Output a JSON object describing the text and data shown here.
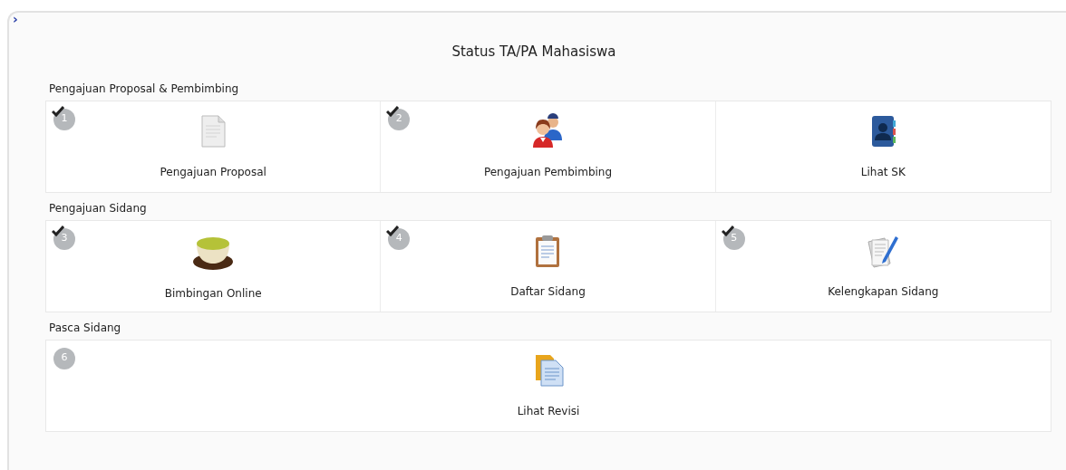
{
  "toggle": "›",
  "title": "Status TA/PA Mahasiswa",
  "sections": [
    {
      "heading": "Pengajuan Proposal & Pembimbing",
      "tiles": [
        {
          "step": "1",
          "checked": true,
          "kind": "document",
          "label": "Pengajuan Proposal"
        },
        {
          "step": "2",
          "checked": true,
          "kind": "people",
          "label": "Pengajuan Pembimbing"
        },
        {
          "kind": "contacts-book",
          "label": "Lihat SK"
        }
      ]
    },
    {
      "heading": "Pengajuan Sidang",
      "tiles": [
        {
          "step": "3",
          "checked": true,
          "kind": "tea",
          "label": "Bimbingan Online"
        },
        {
          "step": "4",
          "checked": true,
          "kind": "clipboard",
          "label": "Daftar Sidang"
        },
        {
          "step": "5",
          "checked": true,
          "kind": "papers-pen",
          "label": "Kelengkapan Sidang"
        }
      ]
    },
    {
      "heading": "Pasca Sidang",
      "tiles": [
        {
          "step": "6",
          "checked": false,
          "kind": "documents",
          "label": "Lihat Revisi"
        }
      ]
    }
  ]
}
